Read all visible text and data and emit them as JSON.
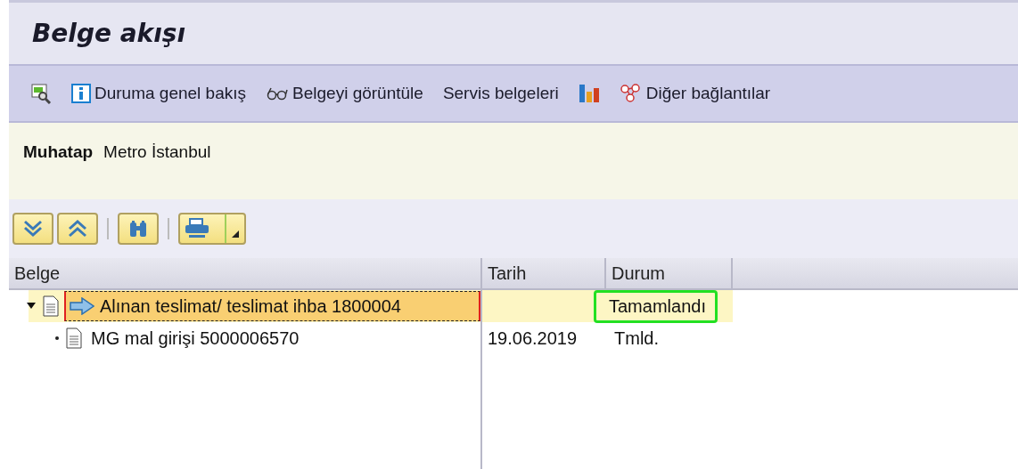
{
  "window": {
    "title": "Belge akışı"
  },
  "toolbar": [
    {
      "label": "Duruma genel bakış"
    },
    {
      "label": "Belgeyi görüntüle"
    },
    {
      "label": "Servis belgeleri"
    },
    {
      "label": "Diğer bağlantılar"
    }
  ],
  "header": {
    "label": "Muhatap",
    "value": "Metro İstanbul"
  },
  "table": {
    "columns": [
      "Belge",
      "Tarih",
      "Durum"
    ],
    "rows": [
      {
        "document": "Alınan teslimat/ teslimat ihba 1800004",
        "status": "Tamamlandı",
        "selected": true,
        "expanded": true,
        "annotated": true,
        "children": [
          {
            "document": "MG mal girişi 5000006570",
            "date": "19.06.2019",
            "status": "Tmld.",
            "selected": false,
            "annotated": false
          }
        ]
      }
    ]
  }
}
